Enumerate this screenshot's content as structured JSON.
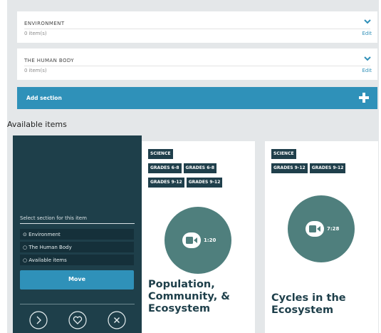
{
  "sections": [
    {
      "name": "ENVIRONMENT",
      "count": "0 item(s)",
      "edit_label": "Edit"
    },
    {
      "name": "THE HUMAN BODY",
      "count": "0 item(s)",
      "edit_label": "Edit"
    }
  ],
  "add_section": {
    "label": "Add section",
    "icon": "plus-icon"
  },
  "available_title": "Available items",
  "move_panel": {
    "prompt": "Select section for this item",
    "options": [
      {
        "label": "Environment",
        "selected": true
      },
      {
        "label": "The Human Body",
        "selected": false
      },
      {
        "label": "Available items",
        "selected": false
      }
    ],
    "move_label": "Move",
    "actions": [
      "next-icon",
      "heart-icon",
      "close-icon"
    ]
  },
  "items": [
    {
      "tags": [
        "SCIENCE",
        "GRADES 6-8",
        "GRADES 6-8",
        "GRADES 9-12",
        "GRADES 9-12"
      ],
      "duration": "1:20",
      "title_lines": [
        "Population,",
        "Community, &",
        "Ecosystem"
      ],
      "media_icon": "video-camera-icon"
    },
    {
      "tags": [
        "SCIENCE",
        "GRADES 9-12",
        "GRADES 9-12"
      ],
      "duration": "7:28",
      "title_lines": [
        "Cycles in the",
        "Ecosystem"
      ],
      "media_icon": "video-camera-icon"
    }
  ],
  "colors": {
    "accent": "#2f91b9",
    "panel": "#1e3f4a",
    "media": "#4f7f7d",
    "background": "#e4e7e9"
  }
}
